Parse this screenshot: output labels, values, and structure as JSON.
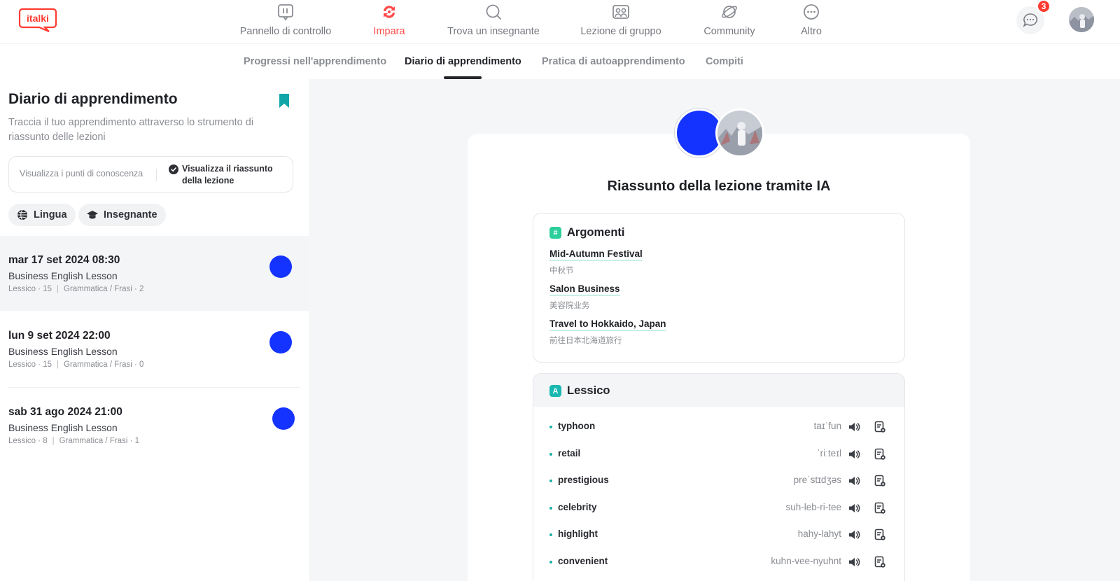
{
  "brand": {
    "logo_text": "italki"
  },
  "nav": {
    "items": [
      {
        "label": "Pannello di controllo",
        "icon": "dashboard-icon"
      },
      {
        "label": "Impara",
        "icon": "learn-icon",
        "active": true
      },
      {
        "label": "Trova un insegnante",
        "icon": "search-icon"
      },
      {
        "label": "Lezione di gruppo",
        "icon": "group-lesson-icon"
      },
      {
        "label": "Community",
        "icon": "community-icon"
      },
      {
        "label": "Altro",
        "icon": "more-icon"
      }
    ],
    "messages_badge": "3"
  },
  "subtabs": [
    {
      "label": "Progressi nell'apprendimento"
    },
    {
      "label": "Diario di apprendimento",
      "active": true
    },
    {
      "label": "Pratica di autoapprendimento"
    },
    {
      "label": "Compiti"
    }
  ],
  "sidebar": {
    "title": "Diario di apprendimento",
    "description": "Traccia il tuo apprendimento attraverso lo strumento di riassunto delle lezioni",
    "toggle": {
      "left": "Visualizza i punti di conoscenza",
      "right": "Visualizza il riassunto della lezione"
    },
    "filters": [
      {
        "label": "Lingua",
        "icon": "language-icon"
      },
      {
        "label": "Insegnante",
        "icon": "graduation-cap-icon"
      }
    ],
    "lessons": [
      {
        "date": "mar 17 set 2024 08:30",
        "name": "Business English Lesson",
        "vocab": "Lessico · 15",
        "grammar": "Grammatica / Frasi · 2"
      },
      {
        "date": "lun 9 set 2024 22:00",
        "name": "Business English Lesson",
        "vocab": "Lessico · 15",
        "grammar": "Grammatica / Frasi · 0"
      },
      {
        "date": "sab 31 ago 2024 21:00",
        "name": "Business English Lesson",
        "vocab": "Lessico · 8",
        "grammar": "Grammatica / Frasi · 1"
      }
    ]
  },
  "summary": {
    "title": "Riassunto della lezione tramite IA",
    "topics_title": "Argomenti",
    "topics_icon_glyph": "#",
    "topics": [
      {
        "en": "Mid-Autumn Festival",
        "zh": "中秋节"
      },
      {
        "en": "Salon Business",
        "zh": "美容院业务"
      },
      {
        "en": "Travel to Hokkaido, Japan",
        "zh": "前往日本北海道旅行"
      }
    ],
    "vocab_title": "Lessico",
    "vocab_icon_glyph": "A",
    "vocab": [
      {
        "word": "typhoon",
        "phonetic": "taɪˈfun"
      },
      {
        "word": "retail",
        "phonetic": "ˈriːteɪl"
      },
      {
        "word": "prestigious",
        "phonetic": "preˈstɪdʒəs"
      },
      {
        "word": "celebrity",
        "phonetic": "suh-leb-ri-tee"
      },
      {
        "word": "highlight",
        "phonetic": "hahy-lahyt"
      },
      {
        "word": "convenient",
        "phonetic": "kuhn-vee-nyuhnt"
      }
    ]
  },
  "colors": {
    "accent": "#ff4a4a",
    "teal": "#18b2a6",
    "topic_icon": "#2ccf9b",
    "vocab_icon": "#19b8b0"
  }
}
